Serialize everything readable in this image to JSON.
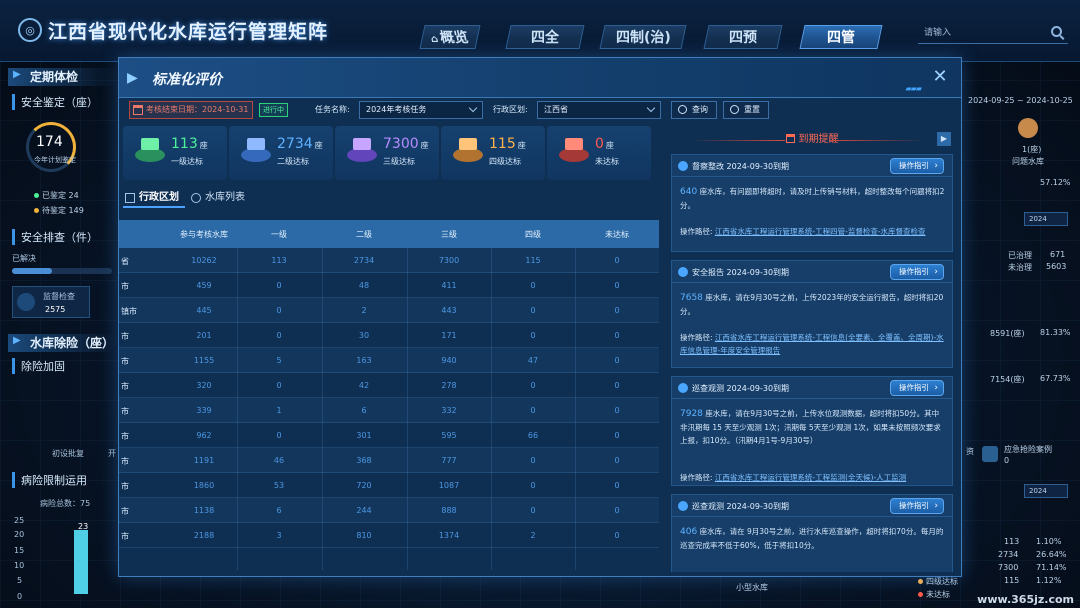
{
  "app": {
    "title": "江西省现代化水库运行管理矩阵",
    "watermark": "www.365jz.com"
  },
  "nav": [
    {
      "label": "概览"
    },
    {
      "label": "四全"
    },
    {
      "label": "四制(治)"
    },
    {
      "label": "四预"
    },
    {
      "label": "四管"
    }
  ],
  "search": {
    "placeholder": "请输入"
  },
  "left": {
    "section1": "定期体检",
    "sub1": "安全鉴定（座）",
    "ring_value": "174",
    "ring_caption": "今年计划鉴定",
    "done_label": "已鉴定 24",
    "todo_label": "待鉴定 149",
    "sub2": "安全排查（件）",
    "resolved": "已解决",
    "card_label": "监督检查",
    "card_value": "2575",
    "section2": "水库除险（座）",
    "sub3": "除险加固",
    "bar_labels": [
      "初设批复",
      "开"
    ],
    "sub4": "病险限制运用",
    "risk_total": "病险总数：75",
    "axis": [
      "25",
      "20",
      "15",
      "10",
      "5",
      "0"
    ],
    "bar_value": "23"
  },
  "right": {
    "date_range": "2024-09-25 ~ 2024-10-25",
    "avatar_count": "1(座)",
    "avatar_label": "问题水库",
    "pct1": "57.12%",
    "year1": "2024",
    "treated": "已治理",
    "treated_val": "671",
    "untreated": "未治理",
    "untreated_val": "5603",
    "stat1": "8591(座)",
    "stat1_pct": "81.33%",
    "stat2": "7154(座)",
    "stat2_pct": "67.73%",
    "emergency": "应急抢险案例",
    "emergency_val": "0",
    "year2": "2024",
    "bottom_rows": [
      {
        "v": "113",
        "p": "1.10%"
      },
      {
        "v": "2734",
        "p": "26.64%"
      },
      {
        "v": "7300",
        "p": "71.14%"
      },
      {
        "v": "115",
        "p": "1.12%"
      }
    ],
    "level4": "四级达标",
    "below": "未达标",
    "small_res": "小型水库",
    "asset": "资"
  },
  "modal": {
    "title": "标准化评价",
    "deadline": "考核结束日期：2024-10-31",
    "status": "进行中",
    "task_label": "任务名称:",
    "task_value": "2024年考核任务",
    "region_label": "行政区划:",
    "region_value": "江西省",
    "query": "查询",
    "reset": "重置",
    "stats": [
      {
        "value": "113",
        "unit": "座",
        "label": "一级达标",
        "color": "#4cf29a"
      },
      {
        "value": "2734",
        "unit": "座",
        "label": "二级达标",
        "color": "#5fb2ff"
      },
      {
        "value": "7300",
        "unit": "座",
        "label": "三级达标",
        "color": "#b58cff"
      },
      {
        "value": "115",
        "unit": "座",
        "label": "四级达标",
        "color": "#ffb14a"
      },
      {
        "value": "0",
        "unit": "座",
        "label": "未达标",
        "color": "#ff5a4d"
      }
    ],
    "tabs": [
      {
        "label": "行政区划"
      },
      {
        "label": "水库列表"
      }
    ],
    "columns": [
      "",
      "参与考核水库",
      "一级",
      "二级",
      "三级",
      "四级",
      "未达标"
    ],
    "rows": [
      [
        "省",
        "10262",
        "113",
        "2734",
        "7300",
        "115",
        "0"
      ],
      [
        "市",
        "459",
        "0",
        "48",
        "411",
        "0",
        "0"
      ],
      [
        "镇市",
        "445",
        "0",
        "2",
        "443",
        "0",
        "0"
      ],
      [
        "市",
        "201",
        "0",
        "30",
        "171",
        "0",
        "0"
      ],
      [
        "市",
        "1155",
        "5",
        "163",
        "940",
        "47",
        "0"
      ],
      [
        "市",
        "320",
        "0",
        "42",
        "278",
        "0",
        "0"
      ],
      [
        "市",
        "339",
        "1",
        "6",
        "332",
        "0",
        "0"
      ],
      [
        "市",
        "962",
        "0",
        "301",
        "595",
        "66",
        "0"
      ],
      [
        "市",
        "1191",
        "46",
        "368",
        "777",
        "0",
        "0"
      ],
      [
        "市",
        "1860",
        "53",
        "720",
        "1087",
        "0",
        "0"
      ],
      [
        "市",
        "1138",
        "6",
        "244",
        "888",
        "0",
        "0"
      ],
      [
        "市",
        "2188",
        "3",
        "810",
        "1374",
        "2",
        "0"
      ]
    ],
    "reminder": {
      "title": "到期提醒",
      "guide": "操作指引",
      "path_label": "操作路径:",
      "cards": [
        {
          "title": "督察整改 2024-09-30到期",
          "num": "640",
          "text": "座水库，有问题即将超时，请及时上传销号材料，超时整改每个问题将扣2分。",
          "path": "江西省水库工程运行管理系统-工程四管-监督检查-水库督查检查"
        },
        {
          "title": "安全报告 2024-09-30到期",
          "num": "7658",
          "text": "座水库，请在9月30号之前，上传2023年的安全运行报告，超时将扣20分。",
          "path": "江西省水库工程运行管理系统-工程信息(全要素、全覆盖、全周期)-水库信息管理-年度安全管理报告"
        },
        {
          "title": "巡查观测 2024-09-30到期",
          "num": "7928",
          "text": "座水库，请在9月30号之前，上传水位观测数据，超时将扣50分。其中非汛期每 15 天至少观测 1次；汛期每 5天至少观测 1次，如果未按照频次要求上报，扣10分。（汛期4月1号-9月30号）",
          "path": "江西省水库工程运行管理系统-工程监测(全天候)-人工监测"
        },
        {
          "title": "巡查观测 2024-09-30到期",
          "num": "406",
          "text": "座水库，请在 9月30号之前，进行水库巡查操作，超时将扣70分。每月的巡查完成率不低于60%，低于将扣10分。",
          "path": ""
        }
      ]
    }
  }
}
